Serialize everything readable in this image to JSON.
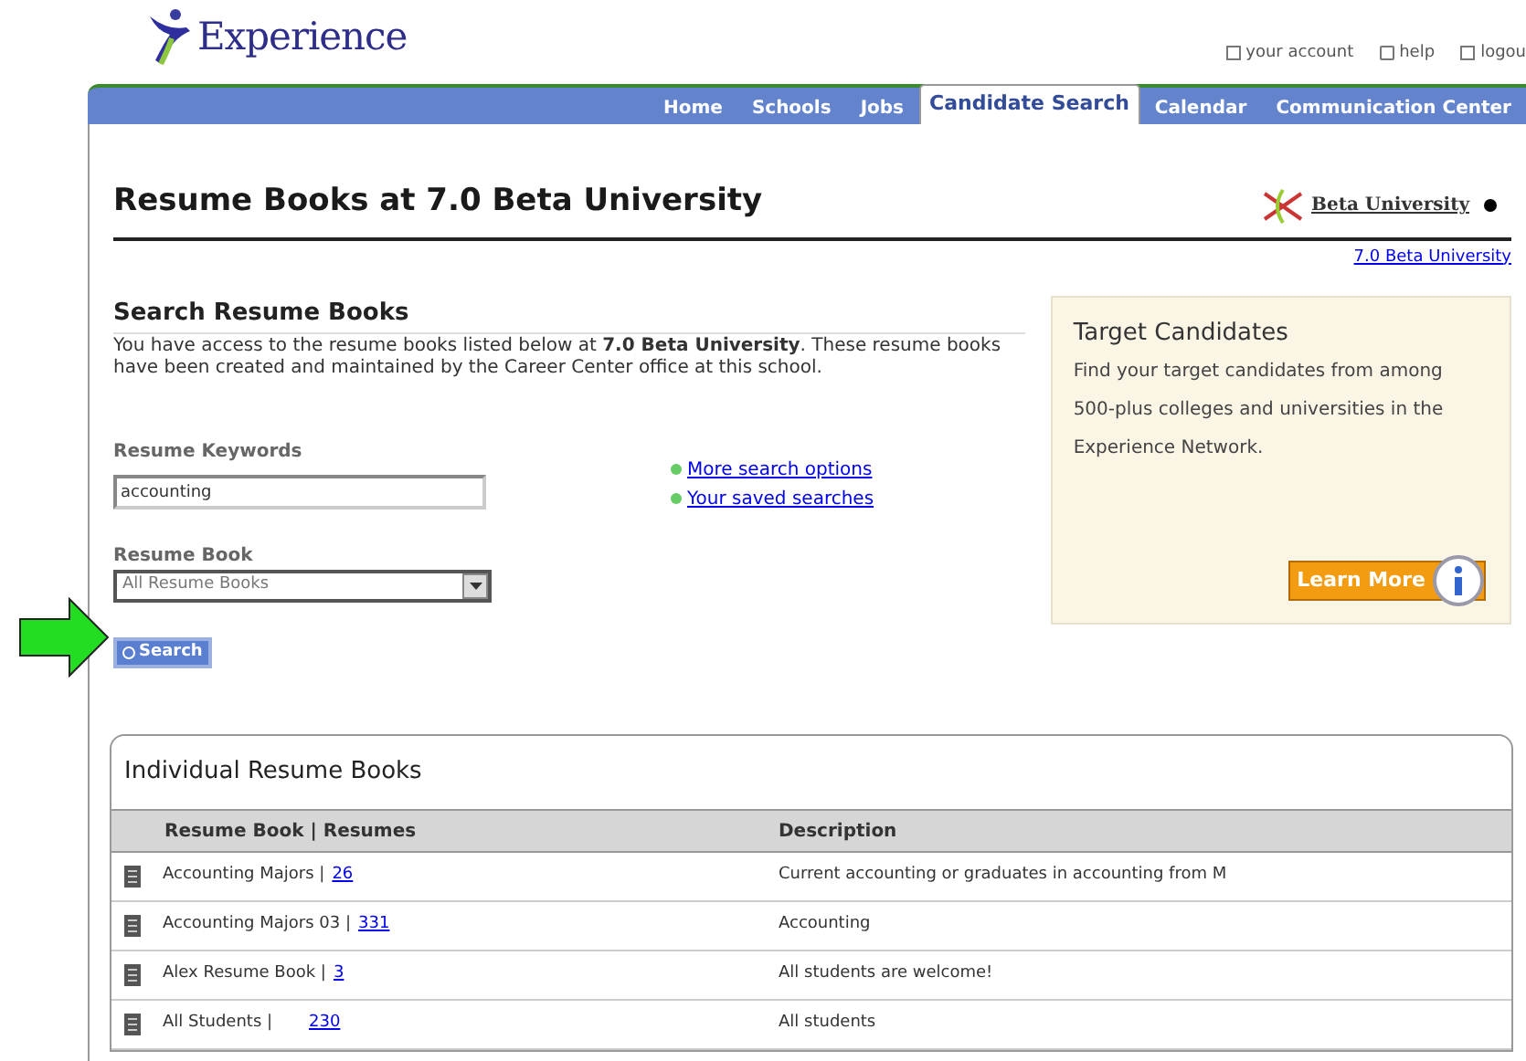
{
  "header": {
    "brand": "Experience",
    "utility_links": [
      {
        "label": "your account",
        "kind": "account"
      },
      {
        "label": "help",
        "kind": "help"
      },
      {
        "label": "logou",
        "kind": "logout"
      }
    ]
  },
  "nav": {
    "tabs": [
      {
        "label": "Home",
        "selected": false
      },
      {
        "label": "Schools",
        "selected": false
      },
      {
        "label": "Jobs",
        "selected": false
      },
      {
        "label": "Candidate Search",
        "selected": true
      },
      {
        "label": "Calendar",
        "selected": false
      },
      {
        "label": "Communication Center",
        "selected": false
      }
    ]
  },
  "page": {
    "title": "Resume Books at 7.0 Beta University",
    "school_logo_text": "Beta University",
    "school_link": "7.0 Beta University"
  },
  "search": {
    "heading": "Search Resume Books",
    "intro": "You have access to the resume books listed below at **7.0 Beta University**. These resume books have been created and maintained by the Career Center office at this school.",
    "keywords_label": "Resume Keywords",
    "keywords_value": "accounting",
    "book_label": "Resume Book",
    "book_value": "All Resume Books",
    "links": [
      "More search options",
      "Your saved searches"
    ],
    "button": "Search"
  },
  "promo": {
    "title": "Target Candidates",
    "text": "Find your target candidates from among 500-plus colleges and universities in the Experience Network.",
    "button": "Learn More"
  },
  "books": {
    "title": "Individual Resume Books",
    "columns": [
      "Resume Book | Resumes",
      "Description"
    ],
    "rows": [
      {
        "name": "Accounting Majors |",
        "count": "26",
        "description": "Current accounting or graduates in accounting from M"
      },
      {
        "name": "Accounting Majors 03 |",
        "count": "331",
        "description": "Accounting"
      },
      {
        "name": "Alex Resume Book |",
        "count": "3",
        "description": "All students are welcome!"
      },
      {
        "name": "All Students |",
        "count": "230",
        "description": "All students"
      }
    ]
  }
}
